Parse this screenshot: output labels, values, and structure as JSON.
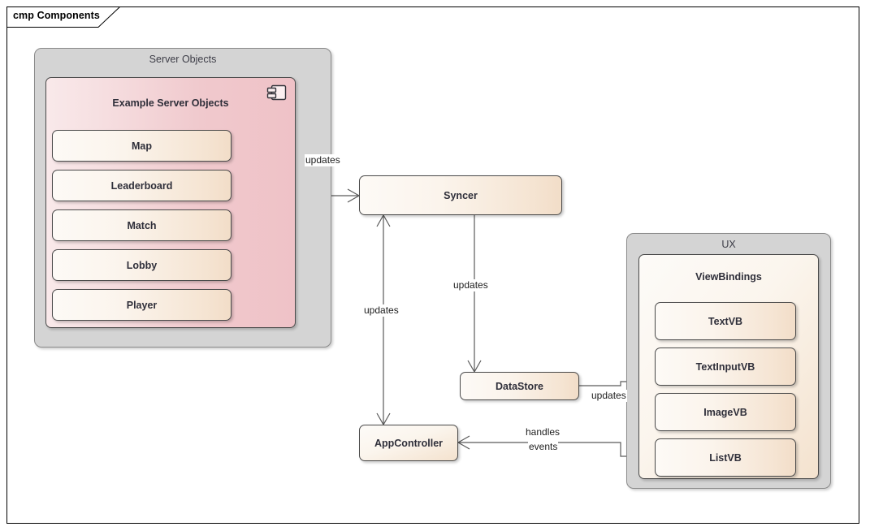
{
  "frame": {
    "tab_label": "cmp Components"
  },
  "server_package": {
    "title": "Server Objects",
    "component": {
      "title": "Example Server Objects",
      "icon": "component-icon",
      "items": [
        {
          "label": "Map"
        },
        {
          "label": "Leaderboard"
        },
        {
          "label": "Match"
        },
        {
          "label": "Lobby"
        },
        {
          "label": "Player"
        }
      ]
    }
  },
  "ux_package": {
    "title": "UX",
    "component": {
      "title": "ViewBindings",
      "items": [
        {
          "label": "TextVB"
        },
        {
          "label": "TextInputVB"
        },
        {
          "label": "ImageVB"
        },
        {
          "label": "ListVB"
        }
      ]
    }
  },
  "nodes": {
    "syncer": "Syncer",
    "datastore": "DataStore",
    "appcontroller": "AppController"
  },
  "edges": {
    "server_syncer": "updates",
    "appcontroller_syncer": "updates",
    "syncer_datastore": "updates",
    "datastore_ux": "updates",
    "ux_appcontroller_line1": "handles",
    "ux_appcontroller_line2": "events"
  },
  "colors": {
    "package_fill": "#d4d4d4",
    "package_border": "#8a8a8a",
    "pink_fill": "#f0c9cd",
    "tan_fill": "#f4e2ce",
    "edge_stroke": "#5a5a5a",
    "text": "#2f2f3a"
  }
}
